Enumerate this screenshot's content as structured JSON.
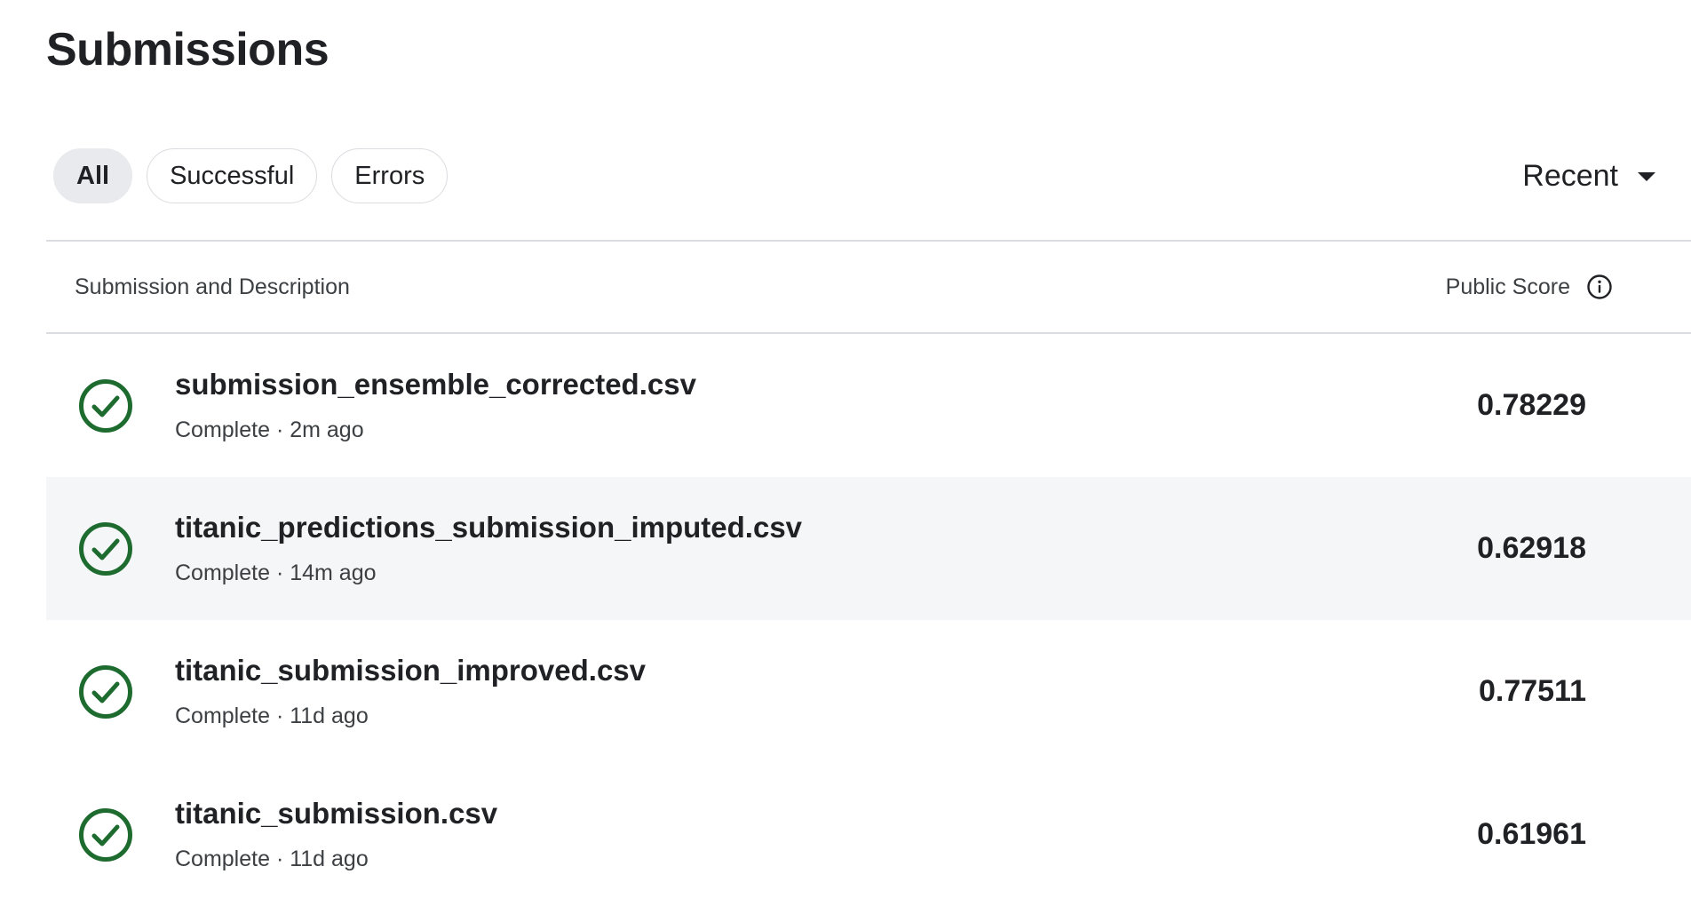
{
  "page": {
    "title": "Submissions"
  },
  "filters": [
    {
      "label": "All",
      "active": true
    },
    {
      "label": "Successful",
      "active": false
    },
    {
      "label": "Errors",
      "active": false
    }
  ],
  "sort": {
    "label": "Recent",
    "icon": "caret-down-icon"
  },
  "table": {
    "columns": {
      "submission": "Submission and Description",
      "score": "Public Score",
      "score_icon": "info-icon"
    },
    "rows": [
      {
        "name": "submission_ensemble_corrected.csv",
        "meta": "Complete · 2m ago",
        "score": "0.78229",
        "status": "success-check-icon"
      },
      {
        "name": "titanic_predictions_submission_imputed.csv",
        "meta": "Complete · 14m ago",
        "score": "0.62918",
        "status": "success-check-icon"
      },
      {
        "name": "titanic_submission_improved.csv",
        "meta": "Complete · 11d ago",
        "score": "0.77511",
        "status": "success-check-icon"
      },
      {
        "name": "titanic_submission.csv",
        "meta": "Complete · 11d ago",
        "score": "0.61961",
        "status": "success-check-icon"
      }
    ]
  },
  "colors": {
    "success": "#1e6b2f",
    "row_highlight": "#f5f6f8",
    "divider": "#dadce0",
    "chip_active_bg": "#e8eaed"
  }
}
